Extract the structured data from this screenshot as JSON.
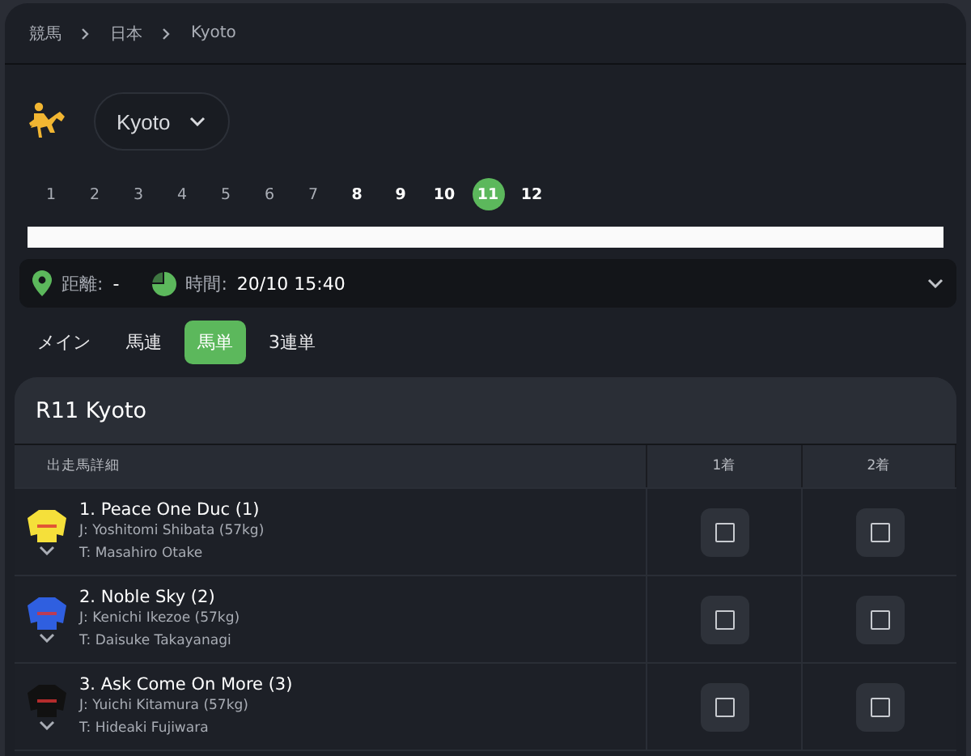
{
  "breadcrumb": [
    "競馬",
    "日本",
    "Kyoto"
  ],
  "venue": {
    "label": "Kyoto"
  },
  "races": [
    {
      "label": "1",
      "finished": true,
      "selected": false
    },
    {
      "label": "2",
      "finished": true,
      "selected": false
    },
    {
      "label": "3",
      "finished": true,
      "selected": false
    },
    {
      "label": "4",
      "finished": true,
      "selected": false
    },
    {
      "label": "5",
      "finished": true,
      "selected": false
    },
    {
      "label": "6",
      "finished": true,
      "selected": false
    },
    {
      "label": "7",
      "finished": true,
      "selected": false
    },
    {
      "label": "8",
      "finished": false,
      "selected": false
    },
    {
      "label": "9",
      "finished": false,
      "selected": false
    },
    {
      "label": "10",
      "finished": false,
      "selected": false
    },
    {
      "label": "11",
      "finished": false,
      "selected": true
    },
    {
      "label": "12",
      "finished": false,
      "selected": false
    }
  ],
  "info": {
    "distance_label": "距離:",
    "distance_value": "-",
    "time_label": "時間:",
    "time_value": "20/10 15:40"
  },
  "tabs": [
    {
      "label": "メイン",
      "selected": false
    },
    {
      "label": "馬連",
      "selected": false
    },
    {
      "label": "馬単",
      "selected": true
    },
    {
      "label": "3連単",
      "selected": false
    }
  ],
  "table": {
    "title": "R11 Kyoto",
    "columns": [
      "出走馬詳細",
      "1着",
      "2着"
    ],
    "rows": [
      {
        "name": "1. Peace One Duc (1)",
        "jockey": "J: Yoshitomi Shibata (57kg)",
        "trainer": "T: Masahiro Otake",
        "color": "#f5e03a",
        "first_checked": false,
        "second_checked": false
      },
      {
        "name": "2. Noble Sky (2)",
        "jockey": "J: Kenichi Ikezoe (57kg)",
        "trainer": "T: Daisuke Takayanagi",
        "color": "#2f5fe0",
        "first_checked": false,
        "second_checked": false
      },
      {
        "name": "3. Ask Come On More (3)",
        "jockey": "J: Yuichi Kitamura (57kg)",
        "trainer": "T: Hideaki Fujiwara",
        "color": "#111111",
        "first_checked": false,
        "second_checked": false
      }
    ]
  }
}
